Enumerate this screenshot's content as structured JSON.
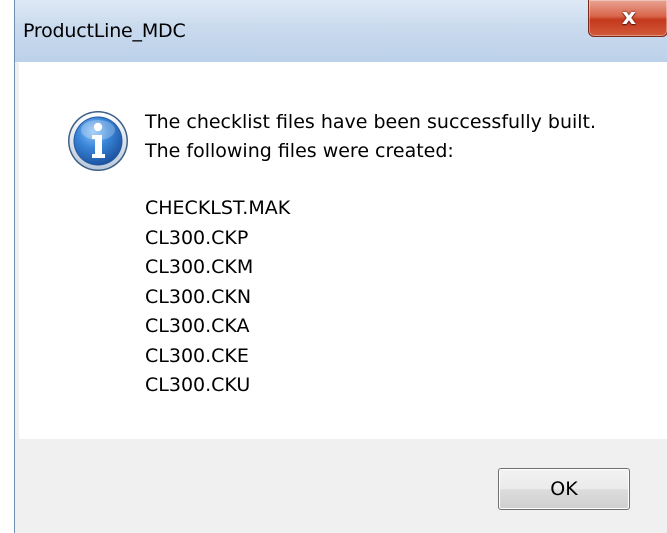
{
  "window": {
    "title": "ProductLine_MDC",
    "close_glyph": "x"
  },
  "message": {
    "icon": "information-icon",
    "line1": "The checklist files have been successfully built.",
    "line2": "The following files were created:"
  },
  "files": [
    "CHECKLST.MAK",
    "CL300.CKP",
    "CL300.CKM",
    "CL300.CKN",
    "CL300.CKA",
    "CL300.CKE",
    "CL300.CKU"
  ],
  "buttons": {
    "ok_label": "OK"
  },
  "colors": {
    "close_button": "#c4381c",
    "titlebar": "#c9daee",
    "info_icon": "#1d5fb8"
  }
}
